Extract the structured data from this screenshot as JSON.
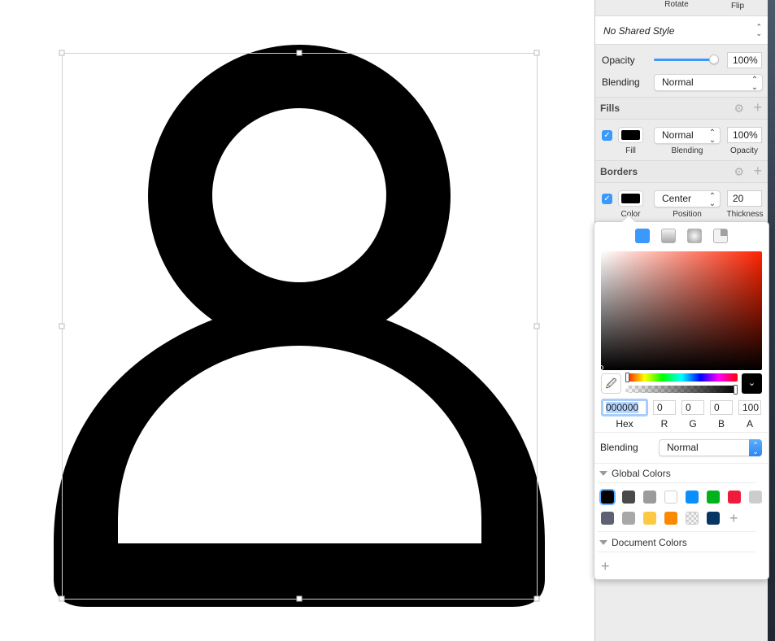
{
  "inspector": {
    "transform_labels": {
      "rotate": "Rotate",
      "flip": "Flip"
    },
    "shared_style": {
      "value": "No Shared Style"
    },
    "opacity": {
      "label": "Opacity",
      "value": "100%",
      "slider_fraction": 1.0
    },
    "blending": {
      "label": "Blending",
      "value": "Normal"
    },
    "fills": {
      "title": "Fills",
      "enabled": true,
      "color": "#000000",
      "blending": "Normal",
      "opacity": "100%",
      "labels": {
        "fill": "Fill",
        "blending": "Blending",
        "opacity": "Opacity"
      }
    },
    "borders": {
      "title": "Borders",
      "enabled": true,
      "color": "#000000",
      "position": "Center",
      "thickness": "20",
      "labels": {
        "color": "Color",
        "position": "Position",
        "thickness": "Thickness"
      }
    }
  },
  "color_picker": {
    "fill_types": [
      "solid",
      "linear-gradient",
      "radial-gradient",
      "angular-gradient"
    ],
    "selected_fill_type": "solid",
    "hue_color": "#ff2200",
    "hex": {
      "label": "Hex",
      "value": "000000"
    },
    "r": {
      "label": "R",
      "value": "0"
    },
    "g": {
      "label": "G",
      "value": "0"
    },
    "b": {
      "label": "B",
      "value": "0"
    },
    "a": {
      "label": "A",
      "value": "100"
    },
    "blending": {
      "label": "Blending",
      "value": "Normal"
    },
    "global_colors": {
      "title": "Global Colors",
      "swatches": [
        "#000000",
        "#4a4a4a",
        "#9b9b9b",
        "#ffffff",
        "#0a8ffd",
        "#00b21b",
        "#f01a3b",
        "#cccccc",
        "#5f6172",
        "#a8a8a8",
        "#fdc844",
        "#fb8a00",
        "transparent",
        "#063664"
      ],
      "selected_index": 0
    },
    "document_colors": {
      "title": "Document Colors",
      "swatches": []
    }
  },
  "canvas": {
    "shape": "person-icon",
    "fill_color": "#000000"
  }
}
